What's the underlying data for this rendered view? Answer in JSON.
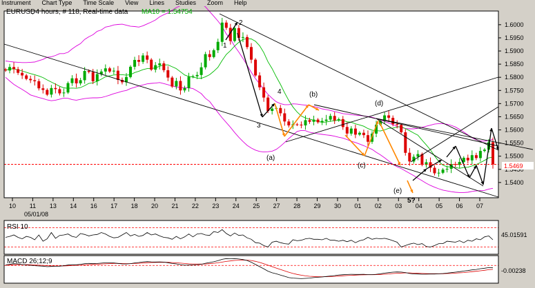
{
  "menu": [
    "Instrument",
    "Chart Type",
    "Time Scale",
    "View",
    "Lines",
    "Studies",
    "Zoom",
    "Help"
  ],
  "colors": {
    "up": "#00aa00",
    "down": "#dd0000",
    "ma": "#00bb00",
    "bollinger": "#dd00dd",
    "price_line": "#ff0000",
    "orange": "#ff8800",
    "frame": "#000000",
    "bg": "#ffffff"
  },
  "chart_data": [
    {
      "type": "candlestick",
      "header": {
        "symbol": "EURUSD",
        "params": ", 4 hours, # 118, Real-time data",
        "ma_label": "MA10 = 1.54754"
      },
      "ylim": [
        1.5342,
        1.6052
      ],
      "y_ticks": [
        "1.6000",
        "1.5950",
        "1.5900",
        "1.5850",
        "1.5800",
        "1.5750",
        "1.5700",
        "1.5650",
        "1.5600",
        "1.5550",
        "1.5500",
        "1.5450",
        "1.5400"
      ],
      "x_labels": [
        "10",
        "11",
        "13",
        "14",
        "16",
        "17",
        "18",
        "20",
        "21",
        "22",
        "23",
        "24",
        "25",
        "27",
        "28",
        "29",
        "30",
        "01",
        "02",
        "03",
        "04",
        "05",
        "06",
        "07"
      ],
      "x_sublabel": "05/01/08",
      "current_price": "1.5469",
      "close": [
        1.5826,
        1.5839,
        1.5831,
        1.5817,
        1.5807,
        1.5794,
        1.5789,
        1.5785,
        1.5758,
        1.5752,
        1.5734,
        1.5759,
        1.5755,
        1.5739,
        1.5742,
        1.5778,
        1.5796,
        1.5777,
        1.5789,
        1.5824,
        1.582,
        1.5785,
        1.5812,
        1.5822,
        1.5834,
        1.5822,
        1.5825,
        1.579,
        1.5781,
        1.5801,
        1.584,
        1.5866,
        1.5859,
        1.5883,
        1.5867,
        1.5829,
        1.5846,
        1.5853,
        1.5827,
        1.5799,
        1.5765,
        1.5786,
        1.575,
        1.5759,
        1.5802,
        1.5804,
        1.5809,
        1.5838,
        1.5888,
        1.5877,
        1.5903,
        1.5935,
        1.6008,
        1.5988,
        1.5938,
        1.5987,
        1.595,
        1.5953,
        1.5915,
        1.5867,
        1.5807,
        1.5762,
        1.5723,
        1.5672,
        1.5681,
        1.5683,
        1.5663,
        1.5632,
        1.5617,
        1.5621,
        1.562,
        1.5617,
        1.5637,
        1.5631,
        1.5639,
        1.5629,
        1.5634,
        1.5639,
        1.5653,
        1.5636,
        1.5641,
        1.5611,
        1.5586,
        1.5605,
        1.5582,
        1.5589,
        1.558,
        1.5555,
        1.5586,
        1.562,
        1.5634,
        1.5655,
        1.5646,
        1.5622,
        1.5619,
        1.5591,
        1.5513,
        1.548,
        1.5498,
        1.5508,
        1.5467,
        1.5477,
        1.5456,
        1.5435,
        1.5437,
        1.5449,
        1.5452,
        1.547,
        1.5467,
        1.5478,
        1.5494,
        1.5484,
        1.5504,
        1.5493,
        1.552,
        1.5525,
        1.5553,
        1.5469
      ],
      "ma10": [
        1.5826,
        1.5832,
        1.5832,
        1.5828,
        1.5824,
        1.5819,
        1.5814,
        1.581,
        1.5805,
        1.5799,
        1.579,
        1.5782,
        1.5774,
        1.5766,
        1.576,
        1.5758,
        1.5759,
        1.5758,
        1.5761,
        1.5768,
        1.5777,
        1.5779,
        1.5785,
        1.5793,
        1.5802,
        1.5806,
        1.5809,
        1.581,
        1.581,
        1.5808,
        1.581,
        1.5818,
        1.5823,
        1.5829,
        1.5833,
        1.5833,
        1.5836,
        1.5842,
        1.5847,
        1.5847,
        1.584,
        1.5833,
        1.5821,
        1.5809,
        1.5803,
        1.5801,
        1.5797,
        1.5796,
        1.5802,
        1.581,
        1.5823,
        1.5838,
        1.5864,
        1.5887,
        1.5901,
        1.5919,
        1.5933,
        1.5944,
        1.5947,
        1.5946,
        1.5937,
        1.592,
        1.5894,
        1.5859,
        1.5833,
        1.5802,
        1.5773,
        1.5741,
        1.5712,
        1.5687,
        1.5668,
        1.5653,
        1.5645,
        1.5641,
        1.5637,
        1.5632,
        1.5629,
        1.563,
        1.5633,
        1.5635,
        1.5637,
        1.5636,
        1.5631,
        1.5629,
        1.5623,
        1.5619,
        1.5614,
        1.5605,
        1.5599,
        1.5597,
        1.5596,
        1.56,
        1.5606,
        1.5607,
        1.5611,
        1.5612,
        1.5605,
        1.5597,
        1.5588,
        1.558,
        1.5561,
        1.5543,
        1.5524,
        1.5501,
        1.548,
        1.5466,
        1.546,
        1.5459,
        1.5457,
        1.5454,
        1.5457,
        1.5458,
        1.5463,
        1.5468,
        1.5476,
        1.5484,
        1.5494,
        1.5496
      ],
      "bb_upper": [
        1.5862,
        1.586,
        1.5858,
        1.5857,
        1.5856,
        1.5856,
        1.5857,
        1.5858,
        1.5863,
        1.5868,
        1.5876,
        1.5878,
        1.5883,
        1.589,
        1.589,
        1.5895,
        1.5908,
        1.5919,
        1.5928,
        1.5944,
        1.5954,
        1.5962,
        1.5975,
        1.598,
        1.5991,
        1.5994,
        1.5999,
        1.6001,
        1.6002,
        1.5998,
        1.5994,
        1.5993,
        1.5991,
        1.5996,
        1.6003,
        1.601,
        1.6018,
        1.603,
        1.6038,
        1.6045,
        1.6055,
        1.6065,
        1.6072,
        1.608,
        1.6085,
        1.6088,
        1.6086,
        1.6078,
        1.6068,
        1.605,
        1.6032,
        1.6014,
        1.5993,
        1.5965,
        1.5945,
        1.5918,
        1.5896,
        1.5872,
        1.5846,
        1.5819,
        1.5795,
        1.5775,
        1.5754,
        1.5735,
        1.572,
        1.5707,
        1.57,
        1.5696,
        1.5696,
        1.5699,
        1.5698,
        1.5696,
        1.5694,
        1.5692,
        1.5689,
        1.5685,
        1.568,
        1.5677,
        1.5674,
        1.567,
        1.5666,
        1.5662,
        1.566,
        1.5658,
        1.5656,
        1.5655,
        1.5653,
        1.5651,
        1.5648,
        1.5643,
        1.5638,
        1.5632,
        1.5626,
        1.562,
        1.5614,
        1.5609,
        1.5605,
        1.5604,
        1.5604,
        1.5606,
        1.561,
        1.5614,
        1.5618,
        1.5622,
        1.5624,
        1.5624,
        1.5621,
        1.5617,
        1.5611,
        1.5602,
        1.5592,
        1.5581,
        1.557,
        1.5562,
        1.5558,
        1.5557,
        1.556,
        1.5564
      ],
      "bb_lower": [
        1.58,
        1.5786,
        1.5773,
        1.5763,
        1.5754,
        1.5744,
        1.5733,
        1.5728,
        1.5723,
        1.5719,
        1.5714,
        1.5711,
        1.5713,
        1.5717,
        1.5721,
        1.572,
        1.5715,
        1.5713,
        1.5716,
        1.5719,
        1.5721,
        1.5722,
        1.5722,
        1.5723,
        1.5727,
        1.5732,
        1.5738,
        1.5742,
        1.5747,
        1.575,
        1.5757,
        1.5762,
        1.5767,
        1.5771,
        1.5775,
        1.5777,
        1.5778,
        1.578,
        1.5776,
        1.5772,
        1.5767,
        1.5763,
        1.5761,
        1.576,
        1.576,
        1.5757,
        1.5748,
        1.5738,
        1.572,
        1.5708,
        1.5687,
        1.5666,
        1.5646,
        1.5628,
        1.561,
        1.559,
        1.5572,
        1.5556,
        1.5541,
        1.5531,
        1.5523,
        1.5518,
        1.5516,
        1.5517,
        1.5519,
        1.5526,
        1.5538,
        1.5552,
        1.5567,
        1.5581,
        1.5594,
        1.5598,
        1.5597,
        1.5591,
        1.5588,
        1.5585,
        1.5583,
        1.5581,
        1.5579,
        1.5576,
        1.5572,
        1.5569,
        1.5563,
        1.5557,
        1.5552,
        1.5546,
        1.554,
        1.5533,
        1.5526,
        1.5515,
        1.5505,
        1.5494,
        1.5482,
        1.5469,
        1.546,
        1.5453,
        1.5444,
        1.5435,
        1.5426,
        1.5416,
        1.5407,
        1.5397,
        1.5389,
        1.5382,
        1.5376,
        1.5371,
        1.5368,
        1.5365,
        1.5363,
        1.5362,
        1.5362,
        1.5363,
        1.5366,
        1.5368,
        1.5369,
        1.537,
        1.5375,
        1.5378
      ],
      "annotations": [
        "1",
        "2",
        "3",
        "4",
        "(a)",
        "(b)",
        "(c)",
        "(d)",
        "(e)",
        "5?"
      ]
    },
    {
      "type": "line",
      "label": "RSI 10",
      "value_label": "45.01591",
      "ylim": [
        15,
        85
      ],
      "reference_lines": [
        70,
        30
      ],
      "values": [
        50,
        52,
        55,
        50,
        47,
        52,
        50,
        45,
        55,
        42,
        47,
        60,
        48,
        54,
        55,
        57,
        52,
        50,
        58,
        56,
        53,
        55,
        56,
        60,
        57,
        52,
        49,
        50,
        55,
        60,
        53,
        56,
        52,
        54,
        60,
        55,
        57,
        53,
        50,
        49,
        46,
        52,
        47,
        51,
        57,
        51,
        57,
        58,
        55,
        54,
        62,
        60,
        66,
        58,
        53,
        59,
        54,
        55,
        49,
        46,
        39,
        38,
        33,
        30,
        40,
        42,
        39,
        37,
        36,
        45,
        43,
        44,
        47,
        48,
        46,
        46,
        45,
        48,
        44,
        44,
        42,
        44,
        41,
        44,
        39,
        43,
        45,
        50,
        46,
        48,
        47,
        48,
        46,
        43,
        40,
        30,
        33,
        36,
        38,
        35,
        37,
        31,
        30,
        33,
        37,
        37,
        42,
        41,
        40,
        43,
        39,
        44,
        42,
        47,
        45,
        51,
        53,
        45
      ]
    },
    {
      "type": "line",
      "label": "MACD 26;12;9",
      "value_label": "-0.00238",
      "ylim": [
        -0.018,
        0.01
      ],
      "reference_lines": [
        0
      ],
      "macd": [
        0.0005,
        0.0012,
        0.0018,
        0.0015,
        0.001,
        0.0005,
        0.0002,
        -0.0002,
        -0.0005,
        -0.0007,
        -0.0012,
        -0.001,
        -0.0008,
        -0.0007,
        -0.0002,
        0.0004,
        0.0008,
        0.0007,
        0.0012,
        0.0018,
        0.0021,
        0.0018,
        0.002,
        0.0024,
        0.0027,
        0.0027,
        0.0026,
        0.0021,
        0.0016,
        0.0015,
        0.0019,
        0.0026,
        0.003,
        0.0036,
        0.0039,
        0.0036,
        0.0035,
        0.0036,
        0.0034,
        0.0028,
        0.002,
        0.0016,
        0.0008,
        0.0003,
        0.0004,
        0.0006,
        0.0008,
        0.0012,
        0.0022,
        0.003,
        0.0038,
        0.0048,
        0.0062,
        0.007,
        0.0068,
        0.007,
        0.0066,
        0.006,
        0.005,
        0.0033,
        0.001,
        -0.0012,
        -0.0034,
        -0.0058,
        -0.0074,
        -0.0085,
        -0.0098,
        -0.011,
        -0.0123,
        -0.0128,
        -0.0131,
        -0.0134,
        -0.0131,
        -0.0128,
        -0.0123,
        -0.012,
        -0.0117,
        -0.0112,
        -0.0107,
        -0.0103,
        -0.0097,
        -0.0094,
        -0.0092,
        -0.009,
        -0.0091,
        -0.0091,
        -0.009,
        -0.0093,
        -0.0093,
        -0.009,
        -0.0085,
        -0.0078,
        -0.0073,
        -0.0068,
        -0.0066,
        -0.0067,
        -0.0072,
        -0.0081,
        -0.0086,
        -0.0087,
        -0.0089,
        -0.0088,
        -0.0087,
        -0.0087,
        -0.0085,
        -0.0082,
        -0.0078,
        -0.0073,
        -0.0068,
        -0.0063,
        -0.0057,
        -0.0052,
        -0.0045,
        -0.0041,
        -0.0033,
        -0.0028,
        -0.0022,
        -0.0024
      ],
      "signal": [
        0.0002,
        0.0004,
        0.0007,
        0.0009,
        0.0009,
        0.0008,
        0.0007,
        0.0005,
        0.0003,
        0.0001,
        -0.0002,
        -0.0004,
        -0.0005,
        -0.0005,
        -0.0005,
        -0.0003,
        -0.0001,
        0.0001,
        0.0003,
        0.0006,
        0.0009,
        0.0011,
        0.0012,
        0.0015,
        0.0017,
        0.0019,
        0.0021,
        0.0021,
        0.002,
        0.0019,
        0.0019,
        0.002,
        0.0022,
        0.0025,
        0.0028,
        0.003,
        0.0031,
        0.0032,
        0.0032,
        0.0032,
        0.0029,
        0.0027,
        0.0024,
        0.002,
        0.0017,
        0.0015,
        0.0014,
        0.0014,
        0.0015,
        0.0018,
        0.0022,
        0.0027,
        0.0034,
        0.0041,
        0.0046,
        0.0051,
        0.0054,
        0.0055,
        0.0054,
        0.005,
        0.0042,
        0.0031,
        0.0018,
        0.0003,
        -0.0012,
        -0.0027,
        -0.0041,
        -0.0055,
        -0.0069,
        -0.0081,
        -0.0091,
        -0.0099,
        -0.0106,
        -0.011,
        -0.0112,
        -0.0114,
        -0.0114,
        -0.0114,
        -0.0112,
        -0.0111,
        -0.0108,
        -0.0105,
        -0.0102,
        -0.01,
        -0.0098,
        -0.0096,
        -0.0095,
        -0.0094,
        -0.0094,
        -0.0093,
        -0.0091,
        -0.0089,
        -0.0086,
        -0.0082,
        -0.0079,
        -0.0077,
        -0.0075,
        -0.0076,
        -0.0078,
        -0.008,
        -0.0081,
        -0.0083,
        -0.0084,
        -0.0084,
        -0.0084,
        -0.0084,
        -0.0082,
        -0.0081,
        -0.0078,
        -0.0075,
        -0.0072,
        -0.0068,
        -0.0063,
        -0.0059,
        -0.0054,
        -0.0049,
        -0.0043,
        -0.004
      ]
    }
  ]
}
